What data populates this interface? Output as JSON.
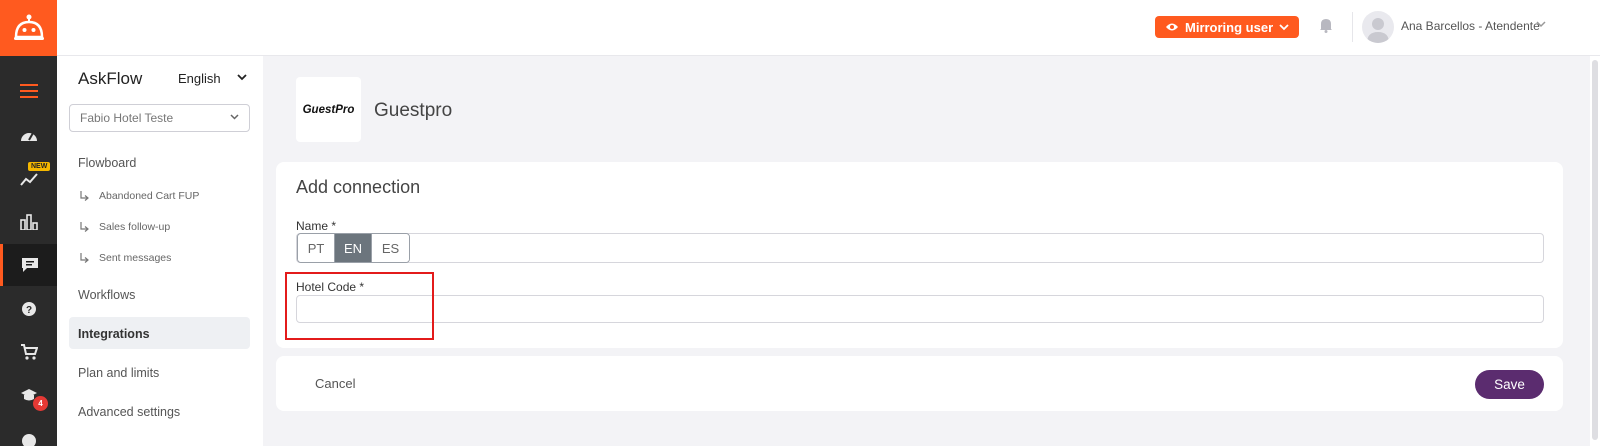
{
  "colors": {
    "accent": "#ff5a1f",
    "save": "#5b2c6f",
    "highlight": "#e31b1b",
    "rail": "#2b2b2b"
  },
  "rail": {
    "icons": [
      "robot-logo-icon",
      "hamburger-menu-icon",
      "dashboard-gauge-icon",
      "trending-icon",
      "bar-chart-icon",
      "chat-icon",
      "help-icon",
      "cart-icon",
      "graduation-cap-icon",
      "user-icon"
    ],
    "new_badge": "NEW",
    "notification_count": "4"
  },
  "header": {
    "mirror_label": "Mirroring user",
    "user_name": "Ana Barcellos - Atendente"
  },
  "sidebar": {
    "brand": "AskFlow",
    "language": "English",
    "hotel_select": "Fabio Hotel Teste",
    "items": [
      {
        "label": "Flowboard"
      },
      {
        "label": "Abandoned Cart FUP"
      },
      {
        "label": "Sales follow-up"
      },
      {
        "label": "Sent messages"
      },
      {
        "label": "Workflows"
      },
      {
        "label": "Integrations"
      },
      {
        "label": "Plan and limits"
      },
      {
        "label": "Advanced settings"
      }
    ]
  },
  "integration": {
    "logo_text": "GuestPro",
    "name": "Guestpro"
  },
  "form": {
    "title": "Add connection",
    "name_label": "Name *",
    "languages": [
      "PT",
      "EN",
      "ES"
    ],
    "active_language": "EN",
    "hotel_code_label": "Hotel Code *",
    "hotel_code_value": ""
  },
  "actions": {
    "cancel": "Cancel",
    "save": "Save"
  }
}
